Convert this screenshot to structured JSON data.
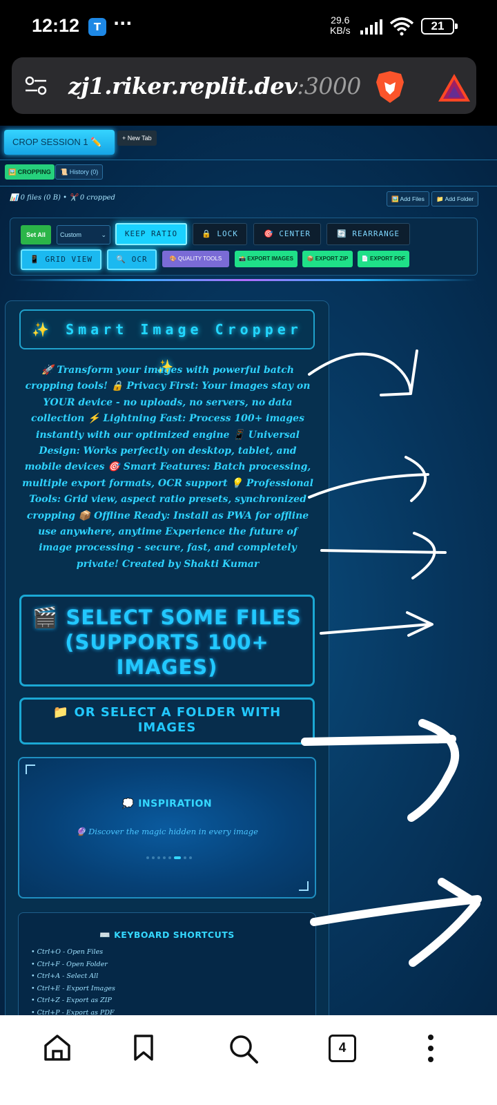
{
  "status_bar": {
    "time": "12:12",
    "app_icon_letter": "T",
    "more": "···",
    "speed_value": "29.6",
    "speed_unit": "KB/s",
    "battery": "21"
  },
  "browser": {
    "url_host": "zj1.riker.replit.dev",
    "url_port": ":3000"
  },
  "tabs": {
    "active_label": "CROP SESSION 1 ✏️",
    "new_tab_label": "+ New Tab"
  },
  "modes": {
    "cropping_label": "🖼️ CROPPING",
    "history_label": "📜 History (0)"
  },
  "file_info": "📊 0 files (0 B) • ✂️ 0 cropped",
  "actions": {
    "add_files": "🖼️ Add Files",
    "add_folder": "📁 Add Folder"
  },
  "toolbar": {
    "set_all": "Set All",
    "ratio_select": "Custom",
    "keep_ratio": "KEEP RATIO",
    "lock": "🔒 LOCK",
    "center": "🎯 CENTER",
    "rearrange": "🔄 REARRANGE",
    "grid_view": "📱 GRID VIEW",
    "ocr": "🔍 OCR",
    "quality_tools": "🎨 QUALITY TOOLS",
    "export_images": "📸 EXPORT IMAGES",
    "export_zip": "📦 EXPORT ZIP",
    "export_pdf": "📄 EXPORT PDF"
  },
  "main": {
    "title": "✨ Smart Image Cropper ✨",
    "description": "🚀 Transform your images with powerful batch cropping tools! 🔒 Privacy First: Your images stay on YOUR device - no uploads, no servers, no data collection ⚡ Lightning Fast: Process 100+ images instantly with our optimized engine 📱 Universal Design: Works perfectly on desktop, tablet, and mobile devices 🎯 Smart Features: Batch processing, multiple export formats, OCR support 💡 Professional Tools: Grid view, aspect ratio presets, synchronized cropping 📦 Offline Ready: Install as PWA for offline use anywhere, anytime Experience the future of image processing - secure, fast, and completely private! Created by Shakti Kumar",
    "select_files": "🎬 SELECT SOME FILES (SUPPORTS 100+ IMAGES)",
    "select_folder": "📁 OR SELECT A FOLDER WITH IMAGES",
    "inspiration_title": "💭 INSPIRATION",
    "inspiration_quote": "🔮 Discover the magic hidden in every image",
    "inspiration_active_dot": 5,
    "shortcuts_title": "⌨️ KEYBOARD SHORTCUTS",
    "shortcuts": [
      "• Ctrl+O - Open Files",
      "• Ctrl+F - Open Folder",
      "• Ctrl+A - Select All",
      "• Ctrl+E - Export Images",
      "• Ctrl+Z - Export as ZIP",
      "• Ctrl+P - Export as PDF"
    ]
  },
  "nav": {
    "tab_count": "4"
  },
  "colors": {
    "accent_cyan": "#22d6ff",
    "export_green": "#1fe088",
    "page_bg": "#06355d"
  }
}
